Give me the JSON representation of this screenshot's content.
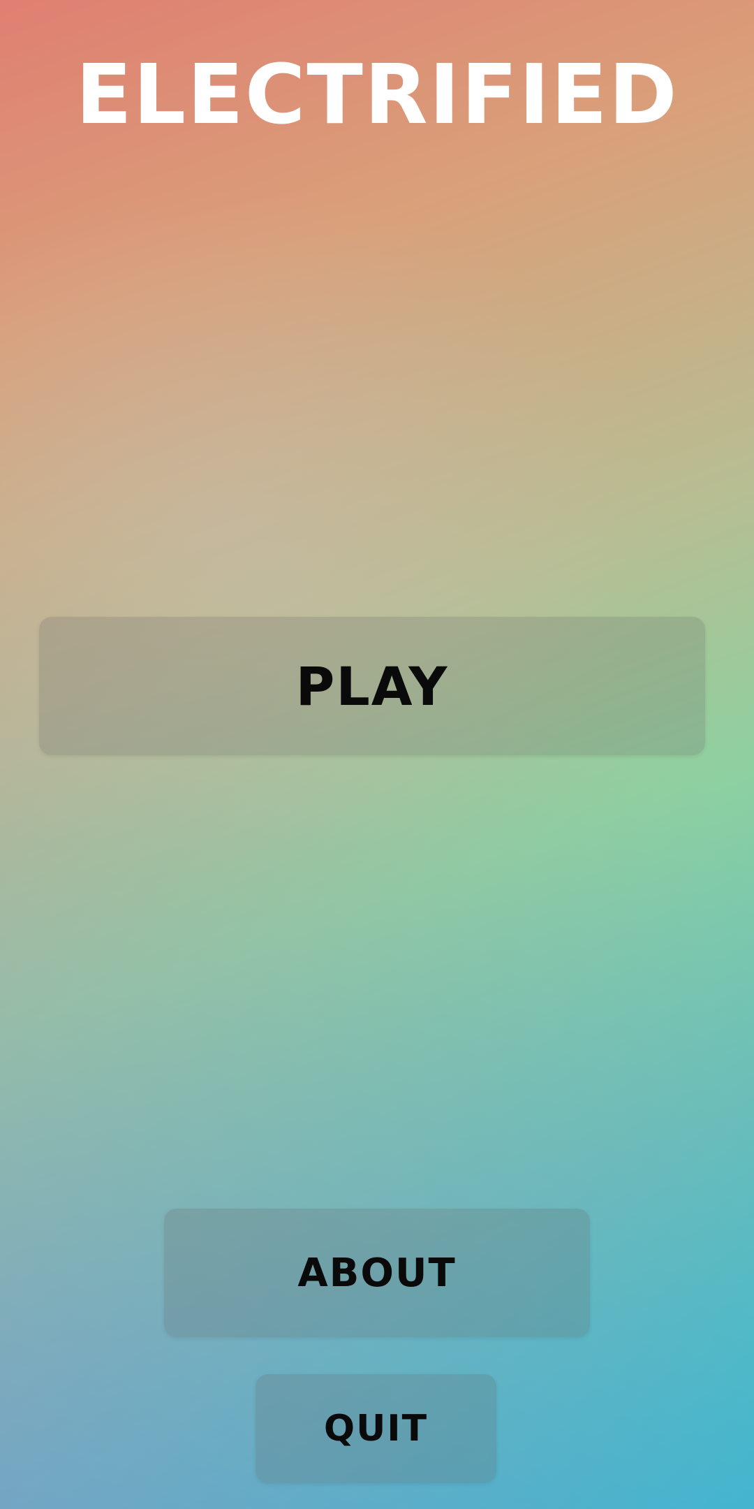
{
  "title": "ELECTRIFIED",
  "menu": {
    "play_label": "PLAY",
    "about_label": "ABOUT",
    "quit_label": "QUIT"
  },
  "colors": {
    "title_text": "#ffffff",
    "button_text": "#0a0a0a",
    "gradient_top_left": "#e07f72",
    "gradient_bottom_right": "#12d2d2"
  }
}
